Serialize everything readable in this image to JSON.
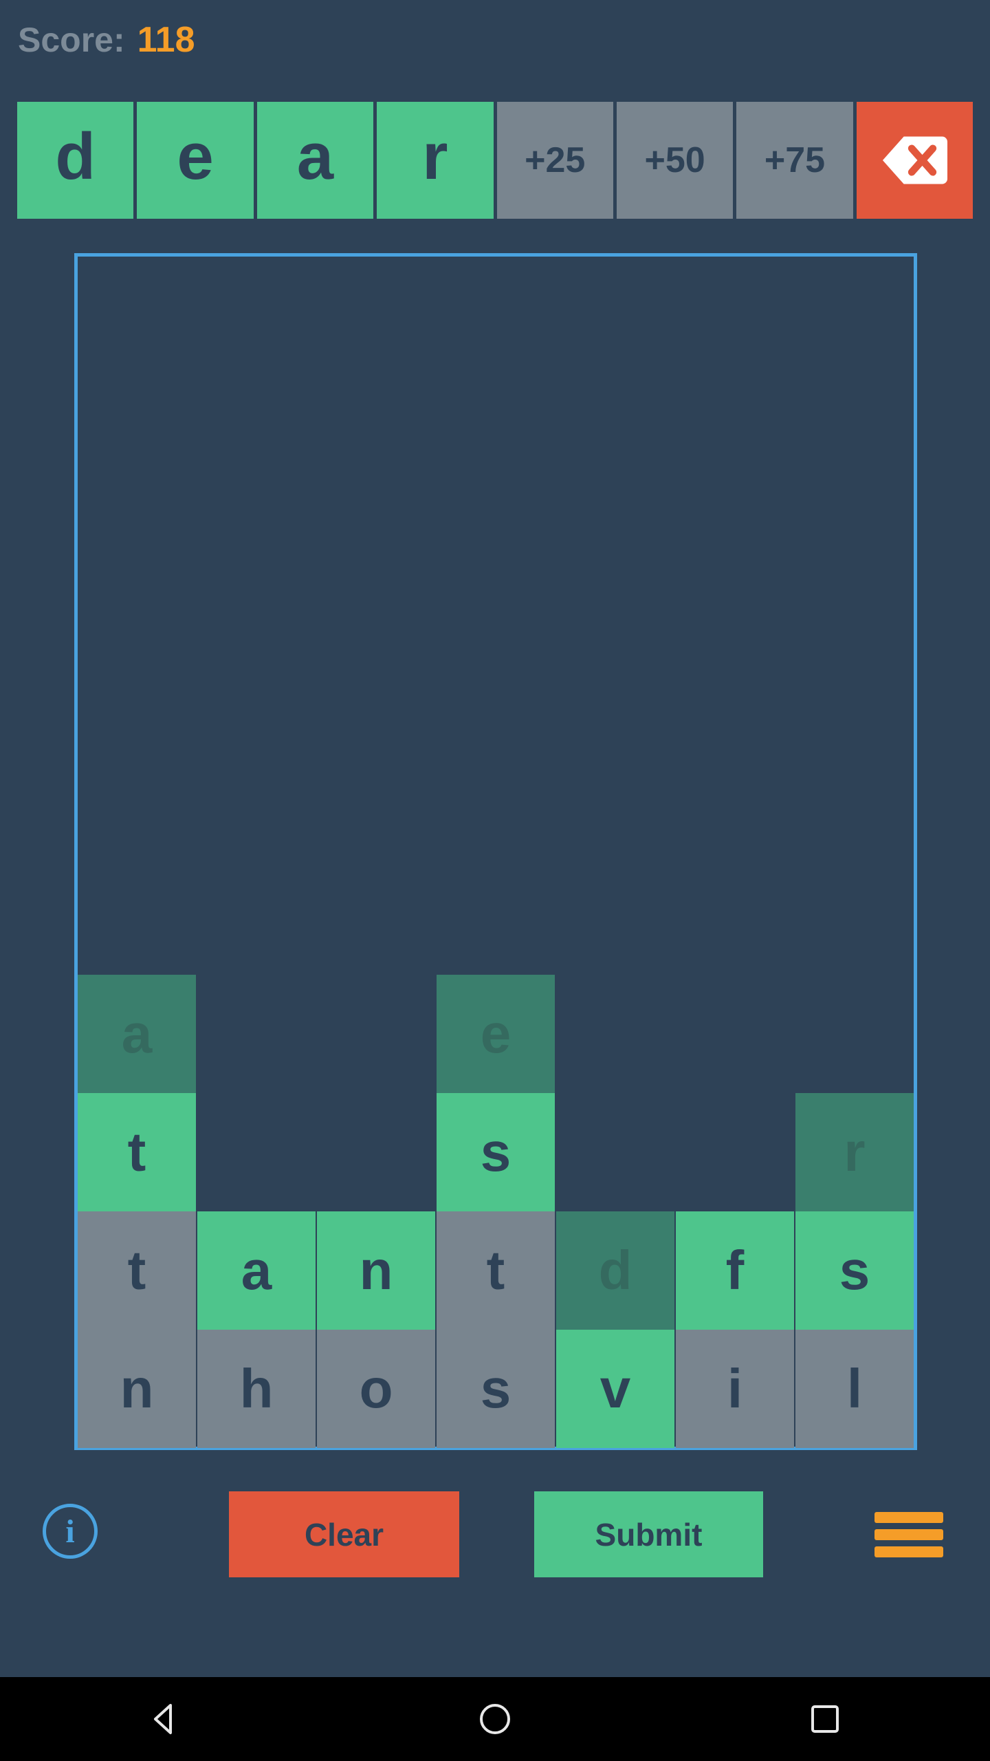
{
  "header": {
    "score_label": "Score:",
    "score_value": "118",
    "label_color": "#7d8b98",
    "value_color": "#f59d28"
  },
  "tray": {
    "cells": [
      {
        "text": "d",
        "kind": "letter"
      },
      {
        "text": "e",
        "kind": "letter"
      },
      {
        "text": "a",
        "kind": "letter"
      },
      {
        "text": "r",
        "kind": "letter"
      },
      {
        "text": "+25",
        "kind": "bonus"
      },
      {
        "text": "+50",
        "kind": "bonus"
      },
      {
        "text": "+75",
        "kind": "bonus"
      }
    ],
    "delete_icon": "backspace-delete-icon",
    "current_word": "dear",
    "letter_color": "#4ec58c",
    "bonus_color": "#79858f",
    "delete_color": "#e2573c"
  },
  "board": {
    "border_color": "#4aa3e0",
    "columns": 7,
    "rows": [
      {
        "cells": [
          {
            "letter": "a",
            "state": "dim"
          },
          {
            "letter": "",
            "state": "empty"
          },
          {
            "letter": "",
            "state": "empty"
          },
          {
            "letter": "e",
            "state": "dim"
          },
          {
            "letter": "",
            "state": "empty"
          },
          {
            "letter": "",
            "state": "empty"
          },
          {
            "letter": "",
            "state": "empty"
          }
        ]
      },
      {
        "cells": [
          {
            "letter": "t",
            "state": "green"
          },
          {
            "letter": "",
            "state": "empty"
          },
          {
            "letter": "",
            "state": "empty"
          },
          {
            "letter": "s",
            "state": "green"
          },
          {
            "letter": "",
            "state": "empty"
          },
          {
            "letter": "",
            "state": "empty"
          },
          {
            "letter": "r",
            "state": "dim"
          }
        ]
      },
      {
        "cells": [
          {
            "letter": "t",
            "state": "gray"
          },
          {
            "letter": "a",
            "state": "green"
          },
          {
            "letter": "n",
            "state": "green"
          },
          {
            "letter": "t",
            "state": "gray"
          },
          {
            "letter": "d",
            "state": "dim"
          },
          {
            "letter": "f",
            "state": "green"
          },
          {
            "letter": "s",
            "state": "green"
          }
        ]
      },
      {
        "cells": [
          {
            "letter": "n",
            "state": "gray"
          },
          {
            "letter": "h",
            "state": "gray"
          },
          {
            "letter": "o",
            "state": "gray"
          },
          {
            "letter": "s",
            "state": "gray"
          },
          {
            "letter": "v",
            "state": "green"
          },
          {
            "letter": "i",
            "state": "gray"
          },
          {
            "letter": "l",
            "state": "gray"
          }
        ]
      }
    ],
    "green_color": "#4ec58c",
    "gray_color": "#79858f",
    "dim_color": "#3a7f6d"
  },
  "actions": {
    "info_icon": "info-circle-icon",
    "info_glyph": "i",
    "clear_label": "Clear",
    "submit_label": "Submit",
    "menu_icon": "hamburger-menu-icon",
    "clear_color": "#e2573c",
    "submit_color": "#4ec58c",
    "info_color": "#4aa3e0",
    "menu_color": "#f59d28"
  },
  "navbar": {
    "back_icon": "triangle-back-icon",
    "home_icon": "circle-home-icon",
    "recents_icon": "square-recents-icon"
  }
}
